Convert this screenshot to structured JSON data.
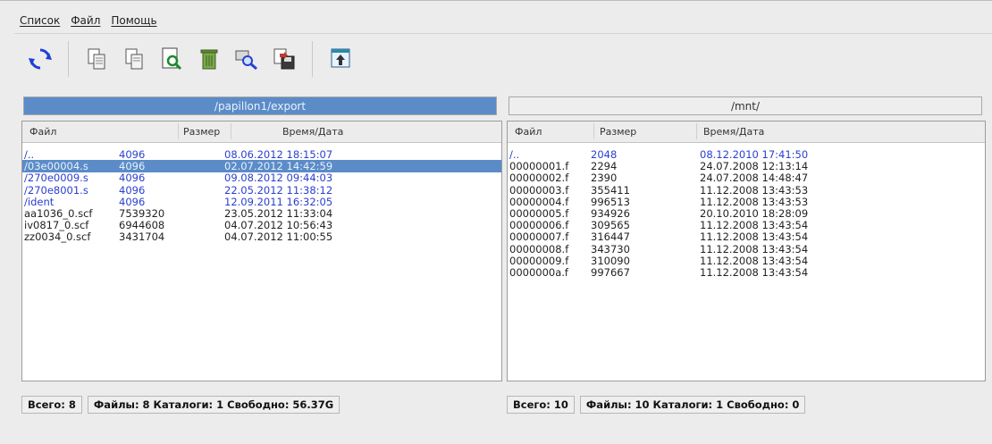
{
  "menu": {
    "items": [
      "Список",
      "Файл",
      "Помощь"
    ]
  },
  "toolbar": {
    "buttons": [
      {
        "name": "refresh-icon"
      },
      {
        "name": "copy-icon"
      },
      {
        "name": "copy-alt-icon"
      },
      {
        "name": "view-file-icon"
      },
      {
        "name": "delete-icon"
      },
      {
        "name": "find-icon"
      },
      {
        "name": "save-icon"
      },
      {
        "name": "upload-icon"
      }
    ]
  },
  "left_panel": {
    "path": "/papillon1/export",
    "columns": {
      "name": "Файл",
      "size": "Размер",
      "date": "Время/Дата"
    },
    "rows": [
      {
        "name": "/..",
        "size": "4096",
        "date": "08.06.2012 18:15:07",
        "type": "dir",
        "selected": false
      },
      {
        "name": "/03e00004.s",
        "size": "4096",
        "date": "02.07.2012 14:42:59",
        "type": "dir",
        "selected": true
      },
      {
        "name": "/270e0009.s",
        "size": "4096",
        "date": "09.08.2012 09:44:03",
        "type": "dir",
        "selected": false
      },
      {
        "name": "/270e8001.s",
        "size": "4096",
        "date": "22.05.2012 11:38:12",
        "type": "dir",
        "selected": false
      },
      {
        "name": "/ident",
        "size": "4096",
        "date": "12.09.2011 16:32:05",
        "type": "dir",
        "selected": false
      },
      {
        "name": "aa1036_0.scf",
        "size": "7539320",
        "date": "23.05.2012 11:33:04",
        "type": "file",
        "selected": false
      },
      {
        "name": "iv0817_0.scf",
        "size": "6944608",
        "date": "04.07.2012 10:56:43",
        "type": "file",
        "selected": false
      },
      {
        "name": "zz0034_0.scf",
        "size": "3431704",
        "date": "04.07.2012 11:00:55",
        "type": "file",
        "selected": false
      }
    ],
    "status": {
      "total": "Всего: 8",
      "summary": "Файлы: 8 Каталоги: 1 Свободно: 56.37G"
    }
  },
  "right_panel": {
    "path": "/mnt/",
    "columns": {
      "name": "Файл",
      "size": "Размер",
      "date": "Время/Дата"
    },
    "rows": [
      {
        "name": "/..",
        "size": "2048",
        "date": "08.12.2010 17:41:50",
        "type": "dir",
        "selected": false
      },
      {
        "name": "00000001.f",
        "size": "2294",
        "date": "24.07.2008 12:13:14",
        "type": "file",
        "selected": false
      },
      {
        "name": "00000002.f",
        "size": "2390",
        "date": "24.07.2008 14:48:47",
        "type": "file",
        "selected": false
      },
      {
        "name": "00000003.f",
        "size": "355411",
        "date": "11.12.2008 13:43:53",
        "type": "file",
        "selected": false
      },
      {
        "name": "00000004.f",
        "size": "996513",
        "date": "11.12.2008 13:43:53",
        "type": "file",
        "selected": false
      },
      {
        "name": "00000005.f",
        "size": "934926",
        "date": "20.10.2010 18:28:09",
        "type": "file",
        "selected": false
      },
      {
        "name": "00000006.f",
        "size": "309565",
        "date": "11.12.2008 13:43:54",
        "type": "file",
        "selected": false
      },
      {
        "name": "00000007.f",
        "size": "316447",
        "date": "11.12.2008 13:43:54",
        "type": "file",
        "selected": false
      },
      {
        "name": "00000008.f",
        "size": "343730",
        "date": "11.12.2008 13:43:54",
        "type": "file",
        "selected": false
      },
      {
        "name": "00000009.f",
        "size": "310090",
        "date": "11.12.2008 13:43:54",
        "type": "file",
        "selected": false
      },
      {
        "name": "0000000a.f",
        "size": "997667",
        "date": "11.12.2008 13:43:54",
        "type": "file",
        "selected": false
      }
    ],
    "status": {
      "total": "Всего: 10",
      "summary": "Файлы: 10 Каталоги: 1 Свободно: 0"
    }
  },
  "colors": {
    "selection": "#5b8cc8",
    "directory_text": "#2a3fd0",
    "file_text": "#222222"
  }
}
